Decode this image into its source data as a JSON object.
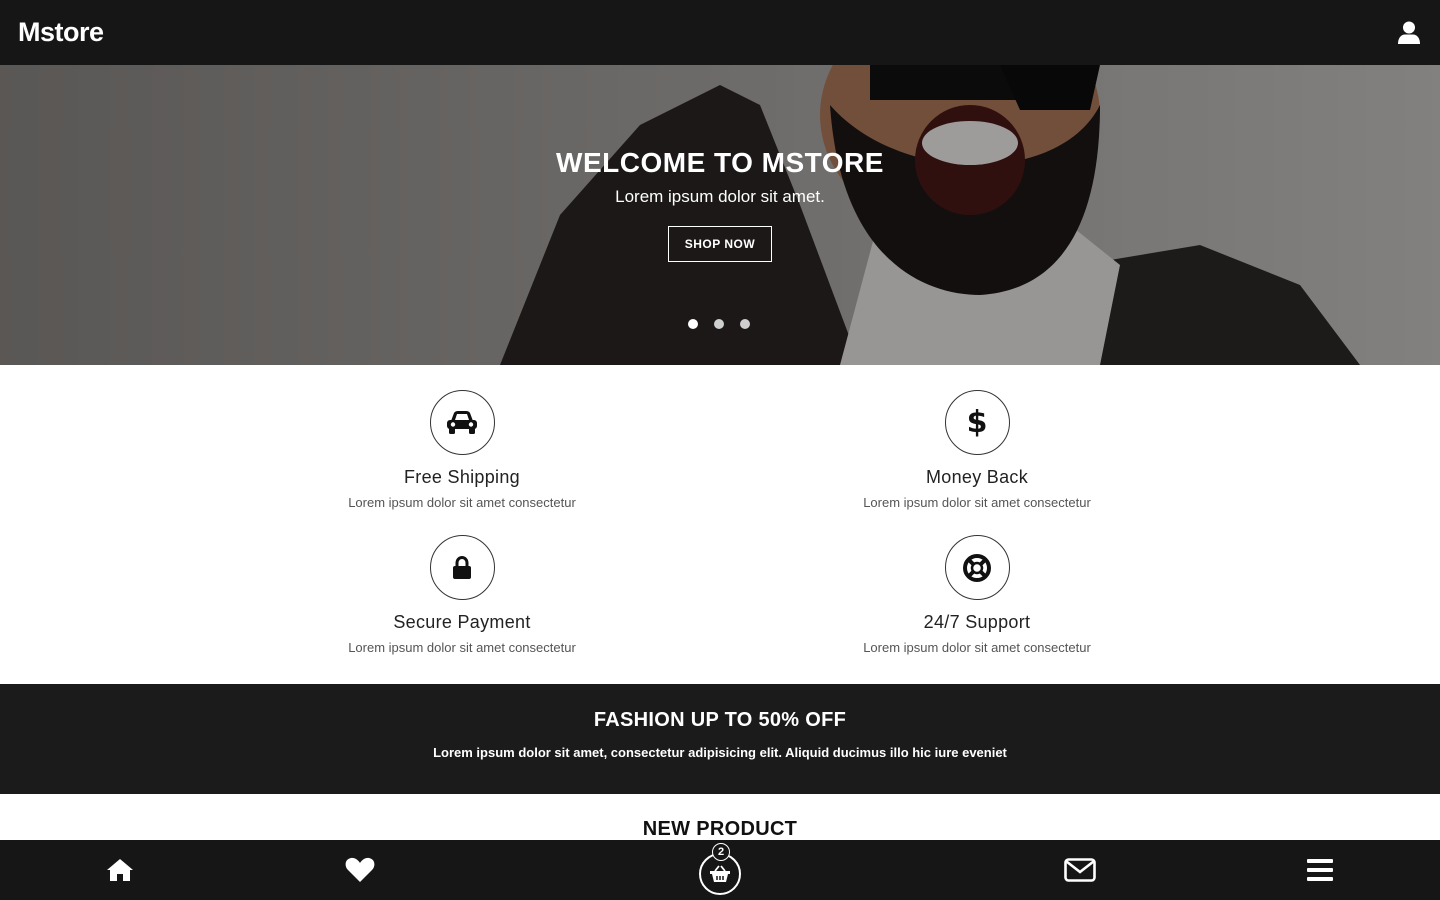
{
  "header": {
    "brand": "Mstore",
    "user_icon": "user-icon"
  },
  "hero": {
    "title": "WELCOME TO MSTORE",
    "subtitle": "Lorem ipsum dolor sit amet.",
    "cta_label": "SHOP NOW",
    "slides_count": 3,
    "active_slide": 1
  },
  "features": [
    {
      "icon": "car-icon",
      "title": "Free Shipping",
      "desc": "Lorem ipsum dolor sit amet consectetur"
    },
    {
      "icon": "dollar-icon",
      "title": "Money Back",
      "desc": "Lorem ipsum dolor sit amet consectetur"
    },
    {
      "icon": "lock-icon",
      "title": "Secure Payment",
      "desc": "Lorem ipsum dolor sit amet consectetur"
    },
    {
      "icon": "lifebuoy-icon",
      "title": "24/7 Support",
      "desc": "Lorem ipsum dolor sit amet consectetur"
    }
  ],
  "promo": {
    "title": "FASHION UP TO 50% OFF",
    "desc": "Lorem ipsum dolor sit amet, consectetur adipisicing elit. Aliquid ducimus illo hic iure eveniet"
  },
  "new_product": {
    "title": "NEW PRODUCT"
  },
  "bottom_nav": {
    "items": [
      "home-icon",
      "heart-icon",
      "cart-icon",
      "envelope-icon",
      "menu-icon"
    ],
    "cart_count": "2"
  },
  "colors": {
    "dark": "#161616",
    "promo_bg": "#1b1b1b",
    "text": "#222222",
    "muted": "#555555"
  }
}
